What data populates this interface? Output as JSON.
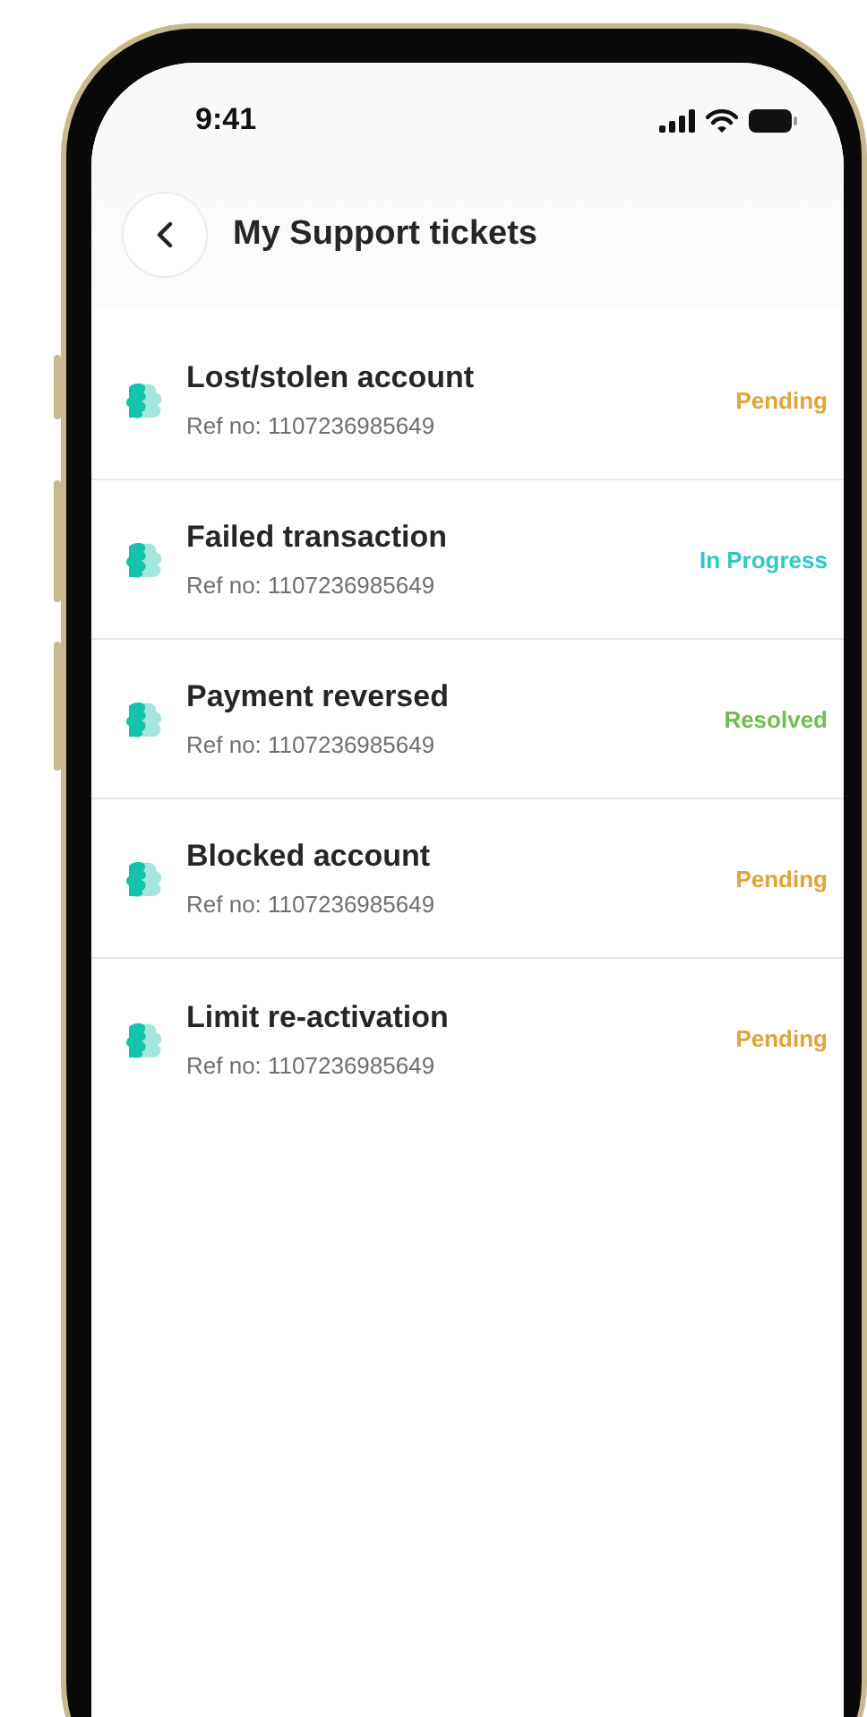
{
  "status_bar": {
    "time": "9:41"
  },
  "header": {
    "title": "My Support tickets"
  },
  "tickets": [
    {
      "title": "Lost/stolen account",
      "ref": "Ref no: 1107236985649",
      "status": "Pending",
      "color": "#e3a23a"
    },
    {
      "title": "Failed transaction",
      "ref": "Ref no: 1107236985649",
      "status": "In Progress",
      "color": "#2ec9c1"
    },
    {
      "title": "Payment reversed",
      "ref": "Ref no: 1107236985649",
      "status": "Resolved",
      "color": "#72bd4f"
    },
    {
      "title": "Blocked account",
      "ref": "Ref no: 1107236985649",
      "status": "Pending",
      "color": "#e3a23a"
    },
    {
      "title": "Limit re-activation",
      "ref": "Ref no: 1107236985649",
      "status": "Pending",
      "color": "#e3a23a"
    }
  ]
}
